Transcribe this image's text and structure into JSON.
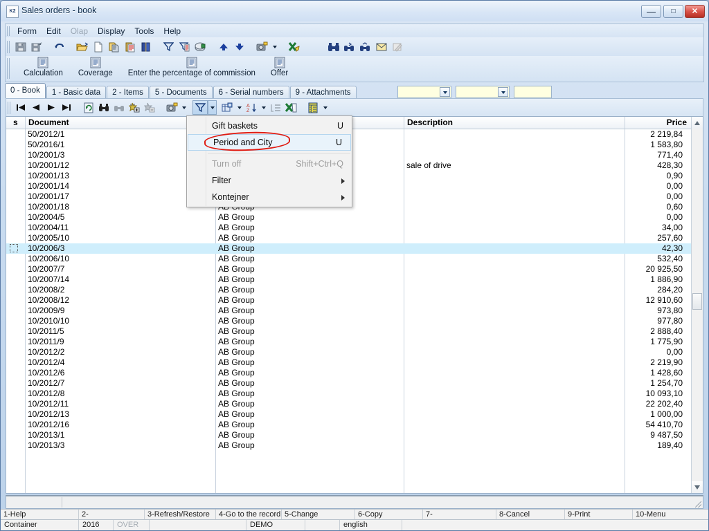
{
  "window": {
    "title": "Sales orders - book",
    "app_icon": "app-icon",
    "buttons": {
      "minimize": "–",
      "maximize": "❐",
      "close": "✕"
    }
  },
  "menubar": {
    "items": [
      {
        "label": "Form",
        "disabled": false
      },
      {
        "label": "Edit",
        "disabled": false
      },
      {
        "label": "Olap",
        "disabled": true
      },
      {
        "label": "Display",
        "disabled": false
      },
      {
        "label": "Tools",
        "disabled": false
      },
      {
        "label": "Help",
        "disabled": false
      }
    ]
  },
  "toolbar_main": {
    "icons": [
      "save-icon",
      "save-as-icon",
      "undo-icon",
      "open-folder-icon",
      "new-document-icon",
      "copy-icon",
      "paste-icon",
      "book-icon",
      "filter-icon",
      "filter-edit-icon",
      "print-icon",
      "move-up-icon",
      "move-down-icon",
      "camera-icon",
      "dropdown-caret-icon",
      "export-excel-icon",
      "binoculars-icon",
      "find-first-icon",
      "find-next-icon",
      "mail-icon",
      "edit-note-icon"
    ]
  },
  "toolbar_big": {
    "buttons": [
      {
        "label": "Calculation",
        "icon": "document-icon"
      },
      {
        "label": "Coverage",
        "icon": "document-icon"
      },
      {
        "label": "Enter the percentage of commission",
        "icon": "document-icon"
      },
      {
        "label": "Offer",
        "icon": "document-icon"
      }
    ]
  },
  "tabs": {
    "items": [
      {
        "label": "0 - Book",
        "active": true
      },
      {
        "label": "1 - Basic data",
        "active": false
      },
      {
        "label": "2 - Items",
        "active": false
      },
      {
        "label": "5 - Documents",
        "active": false
      },
      {
        "label": "6 - Serial numbers",
        "active": false
      },
      {
        "label": "9 - Attachments",
        "active": false
      }
    ],
    "fields": [
      {
        "name": "tab-combo-1",
        "value": "",
        "has_dropdown": true
      },
      {
        "name": "tab-combo-2",
        "value": "",
        "has_dropdown": true
      },
      {
        "name": "tab-field-3",
        "value": "",
        "has_dropdown": false
      }
    ]
  },
  "navbar": {
    "icons": [
      "first-record-icon",
      "previous-record-icon",
      "next-record-icon",
      "last-record-icon",
      "refresh-icon",
      "find-icon",
      "find-next-icon",
      "add-record-icon",
      "delete-record-icon",
      "camera-icon",
      "camera-caret-icon",
      "filter-icon",
      "filter-caret-icon",
      "group-icon",
      "group-caret-icon",
      "sort-az-icon",
      "sort-caret-icon",
      "outline-icon",
      "export-excel-icon",
      "columns-icon",
      "columns-caret-icon"
    ]
  },
  "filter_menu": {
    "items": [
      {
        "label": "Gift baskets",
        "accel": "U",
        "disabled": false,
        "highlighted": false,
        "submenu": false
      },
      {
        "label": "Period and City",
        "accel": "U",
        "disabled": false,
        "highlighted": true,
        "submenu": false
      },
      {
        "separator": true
      },
      {
        "label": "Turn off",
        "accel": "Shift+Ctrl+Q",
        "disabled": true,
        "highlighted": false,
        "submenu": false
      },
      {
        "label": "Filter",
        "accel": "",
        "disabled": false,
        "highlighted": false,
        "submenu": true
      },
      {
        "label": "Kontejner",
        "accel": "",
        "disabled": false,
        "highlighted": false,
        "submenu": true
      }
    ],
    "annotation": {
      "type": "red-ellipse",
      "target": "Period and City",
      "color": "#e01b12"
    }
  },
  "grid": {
    "columns": [
      {
        "key": "s",
        "label": "s",
        "align": "left"
      },
      {
        "key": "document",
        "label": "Document",
        "align": "left"
      },
      {
        "key": "partner",
        "label": "",
        "align": "left"
      },
      {
        "key": "description",
        "label": "Description",
        "align": "left"
      },
      {
        "key": "price",
        "label": "Price",
        "align": "right"
      }
    ],
    "selected_row_index": 11,
    "rows": [
      {
        "document": "50/2012/1",
        "partner": "",
        "description": "",
        "price": "2 219,84"
      },
      {
        "document": "50/2016/1",
        "partner": "",
        "description": "",
        "price": "1 583,80"
      },
      {
        "document": "10/2001/3",
        "partner": "",
        "description": "",
        "price": "771,40"
      },
      {
        "document": "10/2001/12",
        "partner": "",
        "description": "sale of drive",
        "price": "428,30"
      },
      {
        "document": "10/2001/13",
        "partner": "",
        "description": "",
        "price": "0,90"
      },
      {
        "document": "10/2001/14",
        "partner": "",
        "description": "",
        "price": "0,00"
      },
      {
        "document": "10/2001/17",
        "partner": "",
        "description": "",
        "price": "0,00"
      },
      {
        "document": "10/2001/18",
        "partner": "AB Group",
        "description": "",
        "price": "0,60"
      },
      {
        "document": "10/2004/5",
        "partner": "AB Group",
        "description": "",
        "price": "0,00"
      },
      {
        "document": "10/2004/11",
        "partner": "AB Group",
        "description": "",
        "price": "34,00"
      },
      {
        "document": "10/2005/10",
        "partner": "AB Group",
        "description": "",
        "price": "257,60"
      },
      {
        "document": "10/2006/3",
        "partner": "AB Group",
        "description": "",
        "price": "42,30"
      },
      {
        "document": "10/2006/10",
        "partner": "AB Group",
        "description": "",
        "price": "532,40"
      },
      {
        "document": "10/2007/7",
        "partner": "AB Group",
        "description": "",
        "price": "20 925,50"
      },
      {
        "document": "10/2007/14",
        "partner": "AB Group",
        "description": "",
        "price": "1 886,90"
      },
      {
        "document": "10/2008/2",
        "partner": "AB Group",
        "description": "",
        "price": "284,20"
      },
      {
        "document": "10/2008/12",
        "partner": "AB Group",
        "description": "",
        "price": "12 910,60"
      },
      {
        "document": "10/2009/9",
        "partner": "AB Group",
        "description": "",
        "price": "973,80"
      },
      {
        "document": "10/2010/10",
        "partner": "AB Group",
        "description": "",
        "price": "977,80"
      },
      {
        "document": "10/2011/5",
        "partner": "AB Group",
        "description": "",
        "price": "2 888,40"
      },
      {
        "document": "10/2011/9",
        "partner": "AB Group",
        "description": "",
        "price": "1 775,90"
      },
      {
        "document": "10/2012/2",
        "partner": "AB Group",
        "description": "",
        "price": "0,00"
      },
      {
        "document": "10/2012/4",
        "partner": "AB Group",
        "description": "",
        "price": "2 219,90"
      },
      {
        "document": "10/2012/6",
        "partner": "AB Group",
        "description": "",
        "price": "1 428,60"
      },
      {
        "document": "10/2012/7",
        "partner": "AB Group",
        "description": "",
        "price": "1 254,70"
      },
      {
        "document": "10/2012/8",
        "partner": "AB Group",
        "description": "",
        "price": "10 093,10"
      },
      {
        "document": "10/2012/11",
        "partner": "AB Group",
        "description": "",
        "price": "22 202,40"
      },
      {
        "document": "10/2012/13",
        "partner": "AB Group",
        "description": "",
        "price": "1 000,00"
      },
      {
        "document": "10/2012/16",
        "partner": "AB Group",
        "description": "",
        "price": "54 410,70"
      },
      {
        "document": "10/2013/1",
        "partner": "AB Group",
        "description": "",
        "price": "9 487,50"
      },
      {
        "document": "10/2013/3",
        "partner": "AB Group",
        "description": "",
        "price": "189,40"
      }
    ]
  },
  "fkeys": [
    "1-Help",
    "2-",
    "3-Refresh/Restore",
    "4-Go to the record",
    "5-Change",
    "6-Copy",
    "7-",
    "8-Cancel",
    "9-Print",
    "10-Menu"
  ],
  "statusbar": [
    {
      "text": "Container",
      "gray": false
    },
    {
      "text": "2016",
      "gray": false
    },
    {
      "text": "OVER",
      "gray": true
    },
    {
      "text": "",
      "gray": false
    },
    {
      "text": "DEMO",
      "gray": false
    },
    {
      "text": "",
      "gray": false
    },
    {
      "text": "english",
      "gray": false
    },
    {
      "text": "",
      "gray": false
    }
  ],
  "colors": {
    "selection": "#cfeefc",
    "annotation": "#e01b12",
    "field_background": "#ffffe1",
    "menu_highlight": "#e9f3fb"
  }
}
